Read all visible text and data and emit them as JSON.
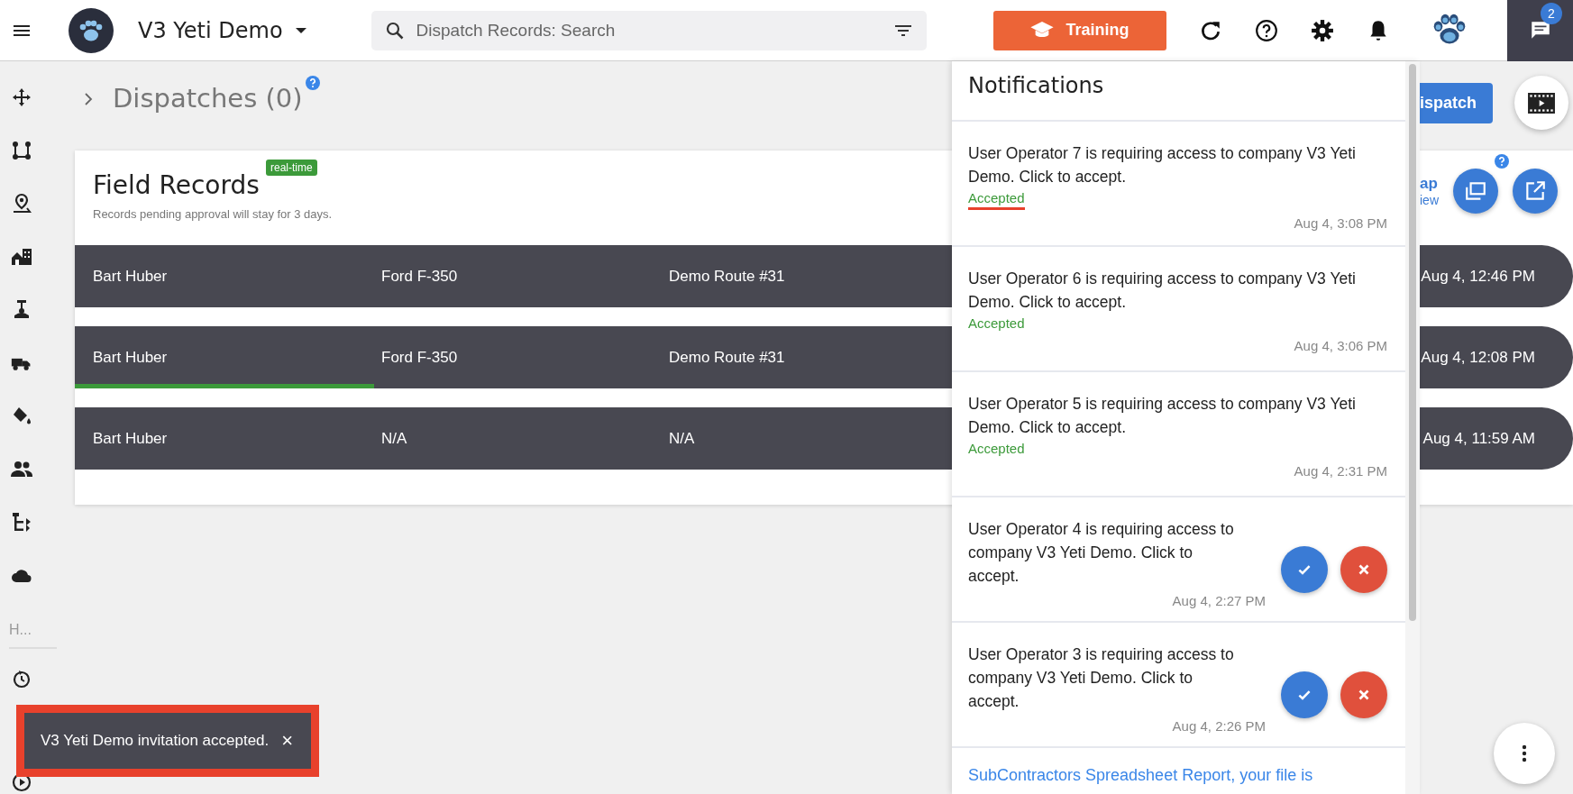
{
  "header": {
    "app_name": "V3 Yeti Demo",
    "search": {
      "placeholder": "Dispatch Records: Search"
    },
    "training_button": "Training",
    "chat_badge": "2"
  },
  "sidebar": {
    "section_label": "H..."
  },
  "page": {
    "title": "Dispatches (0)",
    "dispatch_button": "ispatch",
    "map_link": "ap",
    "map_sublink": "iew"
  },
  "field_records": {
    "title": "Field Records",
    "badge": "real-time",
    "subtitle": "Records pending approval will stay for 3 days.",
    "rows": [
      {
        "driver": "Bart Huber",
        "vehicle": "Ford F-350",
        "route": "Demo Route #31",
        "time": "Aug 4, 12:46 PM"
      },
      {
        "driver": "Bart Huber",
        "vehicle": "Ford F-350",
        "route": "Demo Route #31",
        "time": "Aug 4, 12:08 PM",
        "level": 0.2
      },
      {
        "driver": "Bart Huber",
        "vehicle": "N/A",
        "route": "N/A",
        "time": "Aug 4, 11:59 AM"
      }
    ]
  },
  "notifications": {
    "title": "Notifications",
    "items": [
      {
        "kind": "accepted",
        "text": "User Operator 7 is requiring access to company V3 Yeti Demo. Click to accept.",
        "status": "Accepted",
        "time": "Aug 4, 3:08 PM",
        "highlighted": true
      },
      {
        "kind": "accepted",
        "text": "User Operator 6 is requiring access to company V3 Yeti Demo. Click to accept.",
        "status": "Accepted",
        "time": "Aug 4, 3:06 PM",
        "highlighted": false
      },
      {
        "kind": "accepted",
        "text": "User Operator 5 is requiring access to company V3 Yeti Demo. Click to accept.",
        "status": "Accepted",
        "time": "Aug 4, 2:31 PM",
        "highlighted": false
      },
      {
        "kind": "pending",
        "text": "User Operator 4 is requiring access to company V3 Yeti Demo. Click to accept.",
        "time": "Aug 4, 2:27 PM"
      },
      {
        "kind": "pending",
        "text": "User Operator 3 is requiring access to company V3 Yeti Demo. Click to accept.",
        "time": "Aug 4, 2:26 PM"
      },
      {
        "kind": "report",
        "text": "SubContractors Spreadsheet Report, your file is"
      }
    ]
  },
  "toast": {
    "text": "V3 Yeti Demo invitation accepted.",
    "close": "×",
    "highlighted": true
  }
}
